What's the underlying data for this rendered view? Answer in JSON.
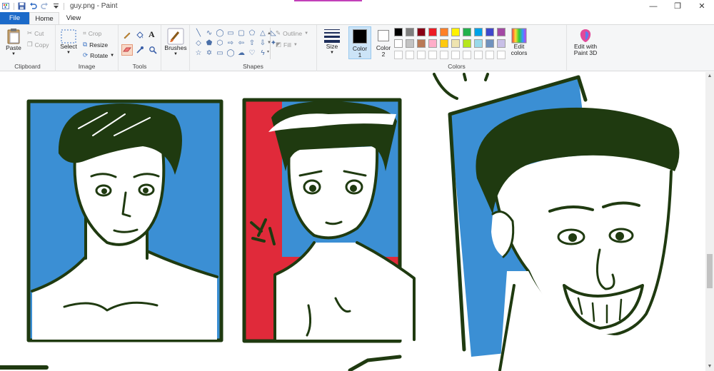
{
  "window": {
    "title": "guy.png - Paint",
    "controls": {
      "minimize": "—",
      "maximize": "❐",
      "close": "✕"
    }
  },
  "tabs": [
    {
      "label": "File"
    },
    {
      "label": "Home"
    },
    {
      "label": "View"
    }
  ],
  "clipboard": {
    "paste": "Paste",
    "cut": "Cut",
    "copy": "Copy",
    "label": "Clipboard"
  },
  "image": {
    "select": "Select",
    "crop": "Crop",
    "resize": "Resize",
    "rotate": "Rotate",
    "label": "Image"
  },
  "tools": {
    "label": "Tools"
  },
  "brushes": {
    "label": "Brushes"
  },
  "shapes": {
    "outline": "Outline",
    "fill": "Fill",
    "label": "Shapes"
  },
  "size": {
    "label": "Size"
  },
  "colors": {
    "color1": "Color 1",
    "color2": "Color 2",
    "edit_colors": "Edit colors",
    "edit_paint3d": "Edit with Paint 3D",
    "label": "Colors",
    "color1_value": "#000000",
    "color2_value": "#ffffff",
    "palette_row1": [
      "#000000",
      "#7f7f7f",
      "#880015",
      "#ed1c24",
      "#ff7f27",
      "#fff200",
      "#22b14c",
      "#00a2e8",
      "#3f48cc",
      "#a349a4"
    ],
    "palette_row2": [
      "#ffffff",
      "#c3c3c3",
      "#b97a57",
      "#ffaec9",
      "#ffc90e",
      "#efe4b0",
      "#b5e61d",
      "#99d9ea",
      "#7092be",
      "#c8bfe7"
    ]
  },
  "artwork": {
    "ink": "#1f3a10",
    "blue": "#3b8fd4",
    "red": "#e02a3a"
  }
}
